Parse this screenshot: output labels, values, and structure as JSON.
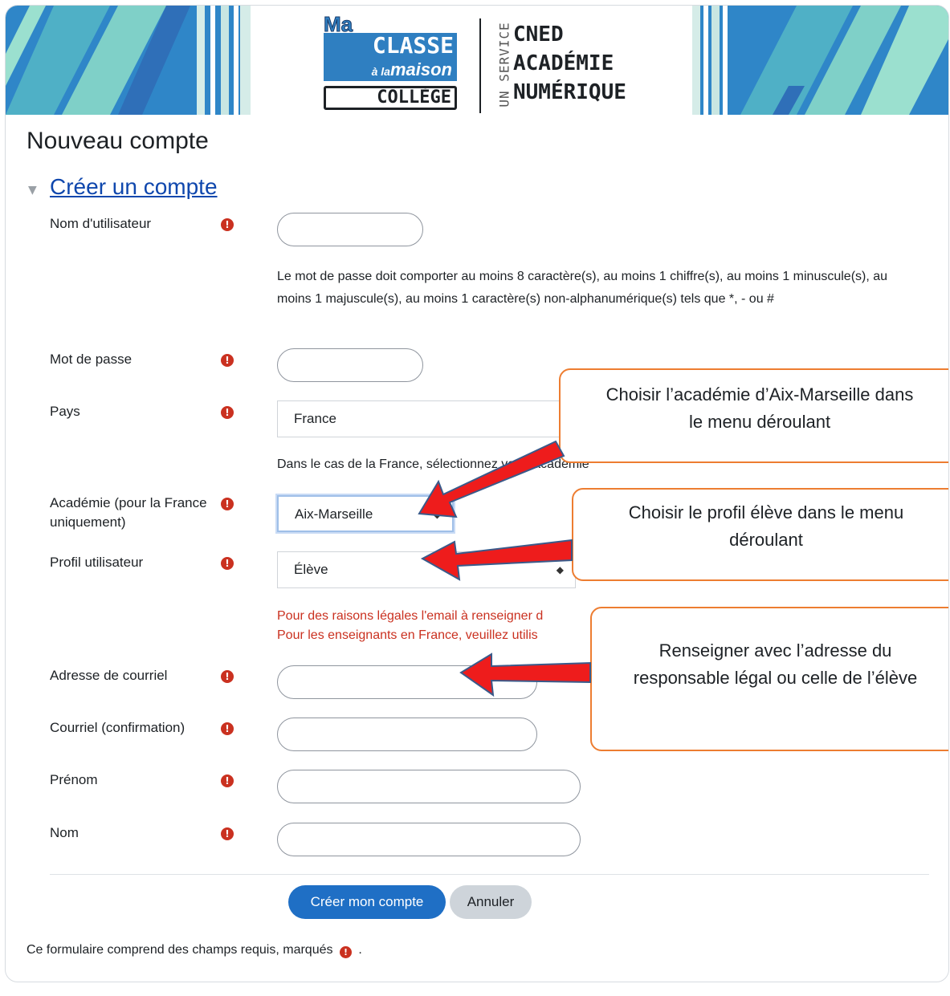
{
  "banner": {
    "logo_ma": "Ma",
    "logo_classe": "CLASSE",
    "logo_a_la": "à la",
    "logo_maison": "maison",
    "logo_college": "COLLÈGE",
    "logo_service": "UN SERVICE",
    "logo_cned_line1": "CNED",
    "logo_cned_line2": "ACADÉMIE",
    "logo_cned_line3": "NUMÉRIQUE"
  },
  "page_title": "Nouveau compte",
  "section_title": "Créer un compte",
  "required_icon": "!",
  "fields": {
    "username_label": "Nom d'utilisateur",
    "password_help": "Le mot de passe doit comporter au moins 8 caractère(s), au moins 1 chiffre(s), au moins 1 minuscule(s), au moins 1 majuscule(s), au moins 1 caractère(s) non-alphanumérique(s) tels que *, - ou #",
    "password_label": "Mot de passe",
    "country_label": "Pays",
    "country_value": "France",
    "country_help": "Dans le cas de la France, sélectionnez votre académie",
    "academy_label": "Académie (pour la France uniquement)",
    "academy_value": "Aix-Marseille",
    "profile_label": "Profil utilisateur",
    "profile_value": "Élève",
    "email_warning_line1": "Pour des raisons légales l'email à renseigner d",
    "email_warning_line2": "Pour les enseignants en France, veuillez utilis",
    "email_label": "Adresse de courriel",
    "email_confirm_label": "Courriel (confirmation)",
    "firstname_label": "Prénom",
    "lastname_label": "Nom"
  },
  "buttons": {
    "submit": "Créer mon compte",
    "cancel": "Annuler"
  },
  "footer_note_before": "Ce formulaire comprend des champs requis, marqués",
  "footer_note_after": ".",
  "callouts": {
    "academy_line1": "Choisir l’académie d’Aix-Marseille dans",
    "academy_line2": "le menu déroulant",
    "profile_line1": "Choisir le profil élève dans le menu",
    "profile_line2": "déroulant",
    "email_line1": "Renseigner avec l’adresse du",
    "email_line2": "responsable légal ou celle de l’élève"
  },
  "colors": {
    "accent": "#1f6fc5",
    "required": "#ca3120",
    "link": "#0f47ad",
    "callout_border": "#ed7d31",
    "arrow_fill": "#ee1c1c"
  }
}
